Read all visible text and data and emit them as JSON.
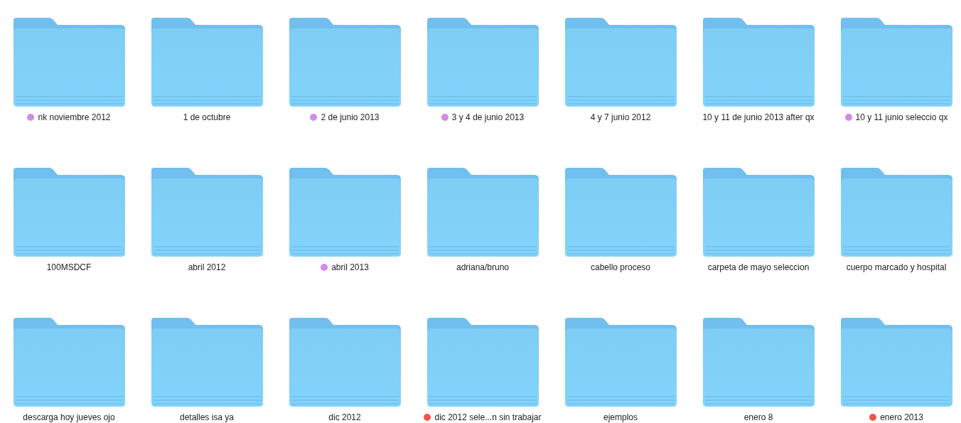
{
  "folders": [
    {
      "name": "nk noviembre 2012",
      "color": "#d48be6"
    },
    {
      "name": "1 de octubre"
    },
    {
      "name": "2 de junio 2013",
      "color": "#d48be6"
    },
    {
      "name": "3 y 4 de junio 2013",
      "color": "#d48be6"
    },
    {
      "name": "4 y 7 junio 2012"
    },
    {
      "name": "10 y 11 de junio 2013 after qx"
    },
    {
      "name": "10 y 11 junio seleccio qx",
      "color": "#d48be6"
    },
    {
      "name": "100MSDCF"
    },
    {
      "name": "abril 2012"
    },
    {
      "name": "abril 2013",
      "color": "#d48be6"
    },
    {
      "name": "adriana/bruno"
    },
    {
      "name": "cabello proceso"
    },
    {
      "name": "carpeta de mayo seleccion"
    },
    {
      "name": "cuerpo marcado y hospital"
    },
    {
      "name": "descarga hoy jueves ojo"
    },
    {
      "name": "detalles isa ya"
    },
    {
      "name": "dic 2012"
    },
    {
      "name": "dic 2012 sele...n sin trabajar",
      "color": "#f4524a"
    },
    {
      "name": "ejemplos"
    },
    {
      "name": "enero 8"
    },
    {
      "name": "enero 2013",
      "color": "#f4524a"
    }
  ]
}
